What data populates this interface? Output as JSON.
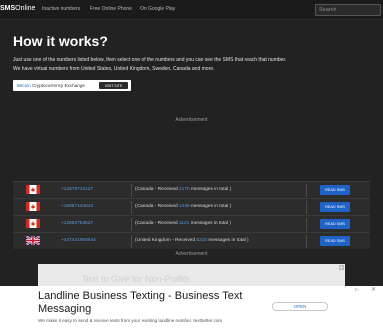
{
  "nav": {
    "brand_prefix": "SMS",
    "brand_suffix": "Online",
    "links": [
      "Inactive numbers",
      "Free Online Phone",
      "On Google Play"
    ],
    "search_placeholder": "Search"
  },
  "main": {
    "heading": "How it works?",
    "intro_line1": "Just use one of the numbers listed below, then select one of the numbers and you can see the SMS that reach that number.",
    "intro_line2": "We have virtual numbers from United States, United Kingdom, Sweden, Canada and more."
  },
  "promo": {
    "highlight": "Bitcoin",
    "text": " Cryptocurrency Exchange",
    "button": "VISIT SITE"
  },
  "ads": {
    "label_top": "Advertisement",
    "label_bottom": "Advertisement",
    "ghost_text": "Text to Give for Non-Profits"
  },
  "numbers": [
    {
      "flag": "canada",
      "number": "+12878710127",
      "country": "Canada",
      "received_prefix": " - Received ",
      "count": "2170",
      "suffix": " messages in total ",
      "button": "READ SMS"
    },
    {
      "flag": "canada",
      "number": "+15887144042",
      "country": "Canada",
      "received_prefix": " - Received ",
      "count": "1445",
      "suffix": " messages in total ",
      "button": "READ SMS"
    },
    {
      "flag": "canada",
      "number": "+12892763527",
      "country": "Canada",
      "received_prefix": " - Received ",
      "count": "1121",
      "suffix": " messages in total ",
      "button": "READ SMS"
    },
    {
      "flag": "uk",
      "number": "+447441959544",
      "country": "United Kingdom",
      "received_prefix": " - Received ",
      "count": "5215",
      "suffix": " messages in total ",
      "button": "READ SMS"
    }
  ],
  "banner": {
    "title": "Landline Business Texting - Business Text Messaging",
    "subtitle": "We make it easy to send & receive texts from your existing landline number. textbetter.com",
    "button": "OPEN",
    "choices": "▷",
    "close": "✕"
  },
  "colors": {
    "background": "#222222",
    "link_blue": "#5d9bdb",
    "button_blue": "#1e63c5"
  }
}
